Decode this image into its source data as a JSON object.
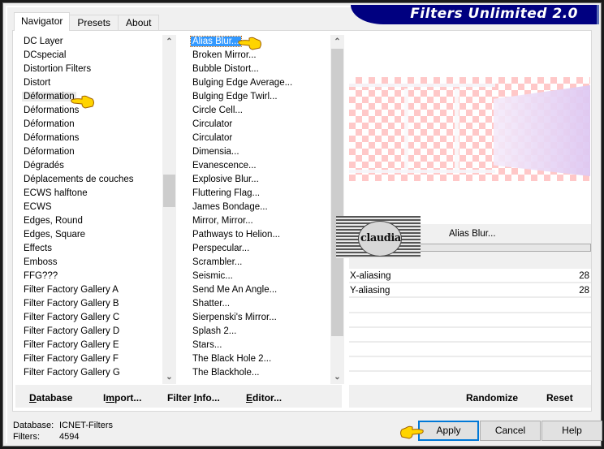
{
  "app": {
    "title": "Filters Unlimited 2.0"
  },
  "tabs": [
    {
      "label": "Navigator",
      "active": true
    },
    {
      "label": "Presets",
      "active": false
    },
    {
      "label": "About",
      "active": false
    }
  ],
  "categories": {
    "items": [
      "DC Layer",
      "DCspecial",
      "Distortion Filters",
      "Distort",
      "Déformation",
      "Déformations",
      "Déformation",
      "Déformations",
      "Déformation",
      "Dégradés",
      "Déplacements de couches",
      "ECWS halftone",
      "ECWS",
      "Edges, Round",
      "Edges, Square",
      "Effects",
      "Emboss",
      "FFG???",
      "Filter Factory Gallery A",
      "Filter Factory Gallery B",
      "Filter Factory Gallery C",
      "Filter Factory Gallery D",
      "Filter Factory Gallery E",
      "Filter Factory Gallery F",
      "Filter Factory Gallery G"
    ],
    "selected": "Déformation"
  },
  "filters": {
    "items": [
      "Alias Blur...",
      "Broken Mirror...",
      "Bubble Distort...",
      "Bulging Edge Average...",
      "Bulging Edge Twirl...",
      "Circle Cell...",
      "Circulator",
      "Circulator",
      "Dimensia...",
      "Evanescence...",
      "Explosive Blur...",
      "Fluttering Flag...",
      "James Bondage...",
      "Mirror, Mirror...",
      "Pathways to Helion...",
      "Perspecular...",
      "Scrambler...",
      "Seismic...",
      "Send Me An Angle...",
      "Shatter...",
      "Sierpenski's Mirror...",
      "Splash 2...",
      "Stars...",
      "The Black Hole 2...",
      "The Blackhole..."
    ],
    "selected": "Alias Blur..."
  },
  "filter_panel": {
    "title": "Alias Blur...",
    "params": [
      {
        "label": "X-aliasing",
        "value": "28"
      },
      {
        "label": "Y-aliasing",
        "value": "28"
      }
    ]
  },
  "watermark": {
    "text": "claudia"
  },
  "left_buttons": {
    "database": "Database",
    "import": "Import...",
    "filter_info": "Filter Info...",
    "editor": "Editor..."
  },
  "right_buttons": {
    "randomize": "Randomize",
    "reset": "Reset"
  },
  "status": {
    "database_label": "Database:",
    "database_value": "ICNET-Filters",
    "filters_label": "Filters:",
    "filters_value": "4594"
  },
  "dialog_buttons": {
    "apply": "Apply",
    "cancel": "Cancel",
    "help": "Help"
  },
  "colors": {
    "brand": "#000080",
    "selection": "#3399ff",
    "default_button_border": "#0078d7",
    "checker": "#ffc8c8"
  }
}
